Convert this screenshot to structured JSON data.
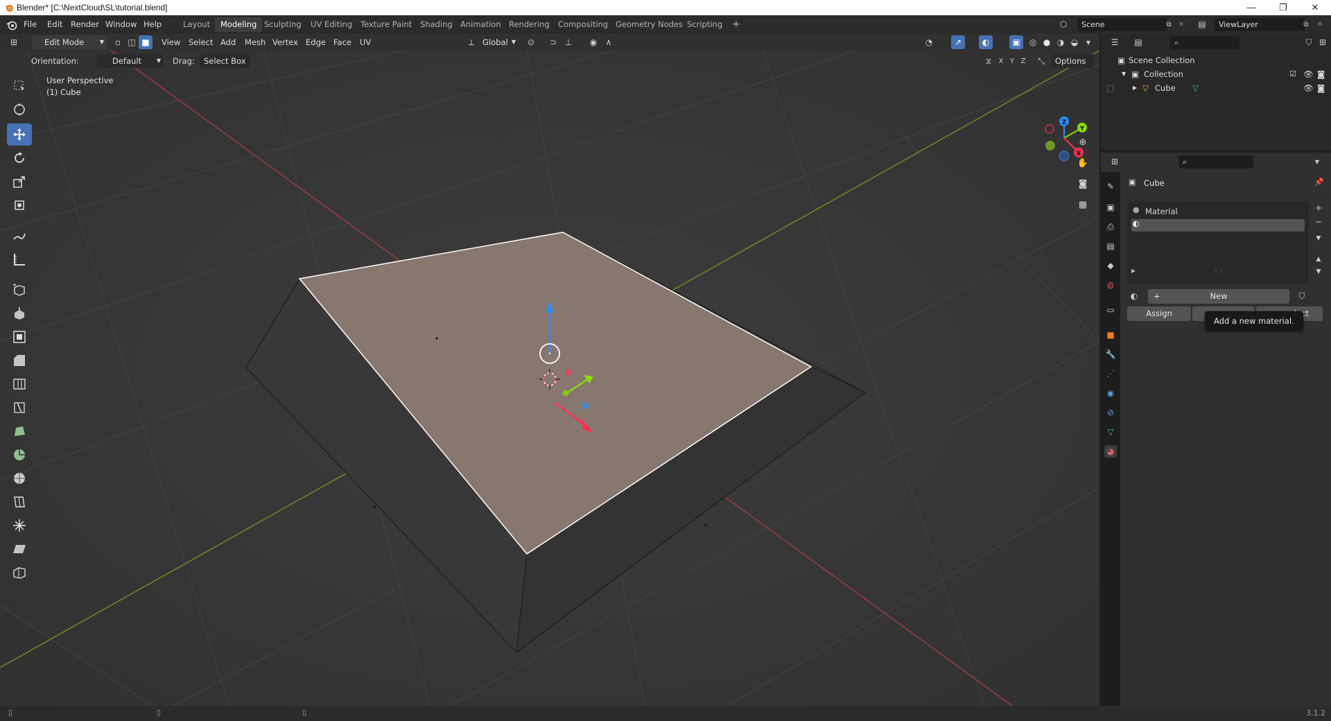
{
  "window": {
    "title": "Blender* [C:\\NextCloud\\SL\\tutorial.blend]",
    "minimize": "—",
    "maximize": "❐",
    "close": "✕"
  },
  "menu": [
    "File",
    "Edit",
    "Render",
    "Window",
    "Help"
  ],
  "workspaces": {
    "tabs": [
      "Layout",
      "Modeling",
      "Sculpting",
      "UV Editing",
      "Texture Paint",
      "Shading",
      "Animation",
      "Rendering",
      "Compositing",
      "Geometry Nodes",
      "Scripting"
    ],
    "active": "Modeling",
    "add": "+"
  },
  "scene": {
    "name": "Scene",
    "view_layer": "ViewLayer"
  },
  "viewport_header": {
    "mode": "Edit Mode",
    "menus": [
      "View",
      "Select",
      "Add",
      "Mesh",
      "Vertex",
      "Edge",
      "Face",
      "UV"
    ],
    "transform_orientation": "Global",
    "orientation_label": "Orientation:",
    "orientation_value": "Default",
    "drag_label": "Drag:",
    "drag_value": "Select Box",
    "options": "Options",
    "axes": [
      "X",
      "Y",
      "Z"
    ]
  },
  "viewport": {
    "view_name": "User Perspective",
    "object_name": "(1) Cube",
    "gizmo_labels": {
      "x": "X",
      "y": "Y",
      "z": "Z"
    }
  },
  "outliner": {
    "root": "Scene Collection",
    "collection": "Collection",
    "object": "Cube"
  },
  "properties": {
    "object_name": "Cube",
    "material_slot": "Material",
    "new_button": "New",
    "assign_button": "Assign",
    "select_button_partial": "lect",
    "tooltip": "Add a new material."
  },
  "statusbar": {
    "version": "3.1.2"
  },
  "colors": {
    "accent": "#4772b3",
    "x_axis": "#ff3352",
    "y_axis": "#8bdc00",
    "z_axis": "#2890ff",
    "selected_face": "#86766f"
  }
}
